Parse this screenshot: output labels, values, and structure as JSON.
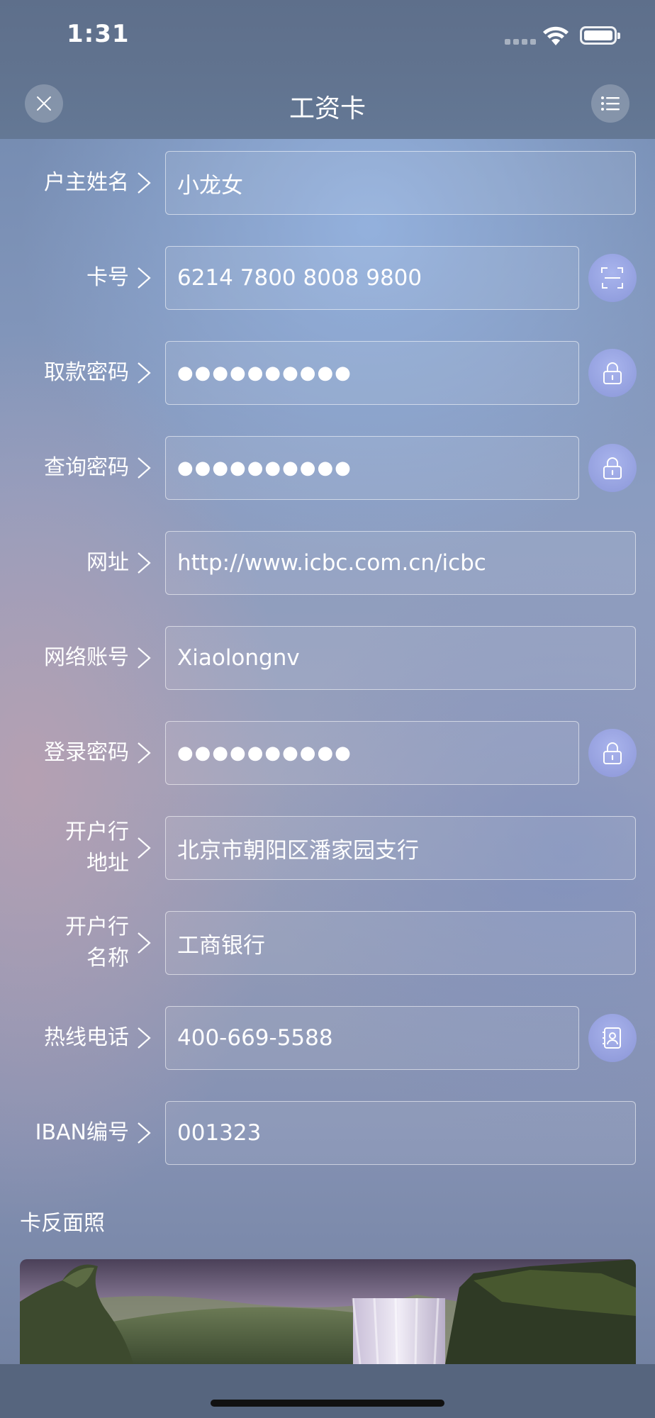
{
  "status_bar": {
    "time": "1:31"
  },
  "nav": {
    "title": "工资卡",
    "close_icon": "close-icon",
    "menu_icon": "list-icon"
  },
  "rows": [
    {
      "label": "户主姓名",
      "value": "小龙女",
      "action_icon": ""
    },
    {
      "label": "卡号",
      "value": "6214 7800 8008 9800",
      "action_icon": "scan-icon"
    },
    {
      "label": "取款密码",
      "value": "●●●●●●●●●●",
      "action_icon": "lock-icon"
    },
    {
      "label": "查询密码",
      "value": "●●●●●●●●●●",
      "action_icon": "lock-icon"
    },
    {
      "label": "网址",
      "value": "http://www.icbc.com.cn/icbc",
      "action_icon": ""
    },
    {
      "label": "网络账号",
      "value": "Xiaolongnv",
      "action_icon": ""
    },
    {
      "label": "登录密码",
      "value": "●●●●●●●●●●",
      "action_icon": "lock-icon"
    },
    {
      "label": "开户行\n地址",
      "value": "北京市朝阳区潘家园支行",
      "action_icon": ""
    },
    {
      "label": "开户行\n名称",
      "value": "工商银行",
      "action_icon": ""
    },
    {
      "label": "热线电话",
      "value": "400-669-5588",
      "action_icon": "contact-icon"
    },
    {
      "label": "IBAN编号",
      "value": "001323",
      "action_icon": ""
    }
  ],
  "section": {
    "card_back_title": "卡反面照"
  },
  "colors": {
    "accent_button": "#9aa4ec",
    "text": "#ffffff"
  }
}
